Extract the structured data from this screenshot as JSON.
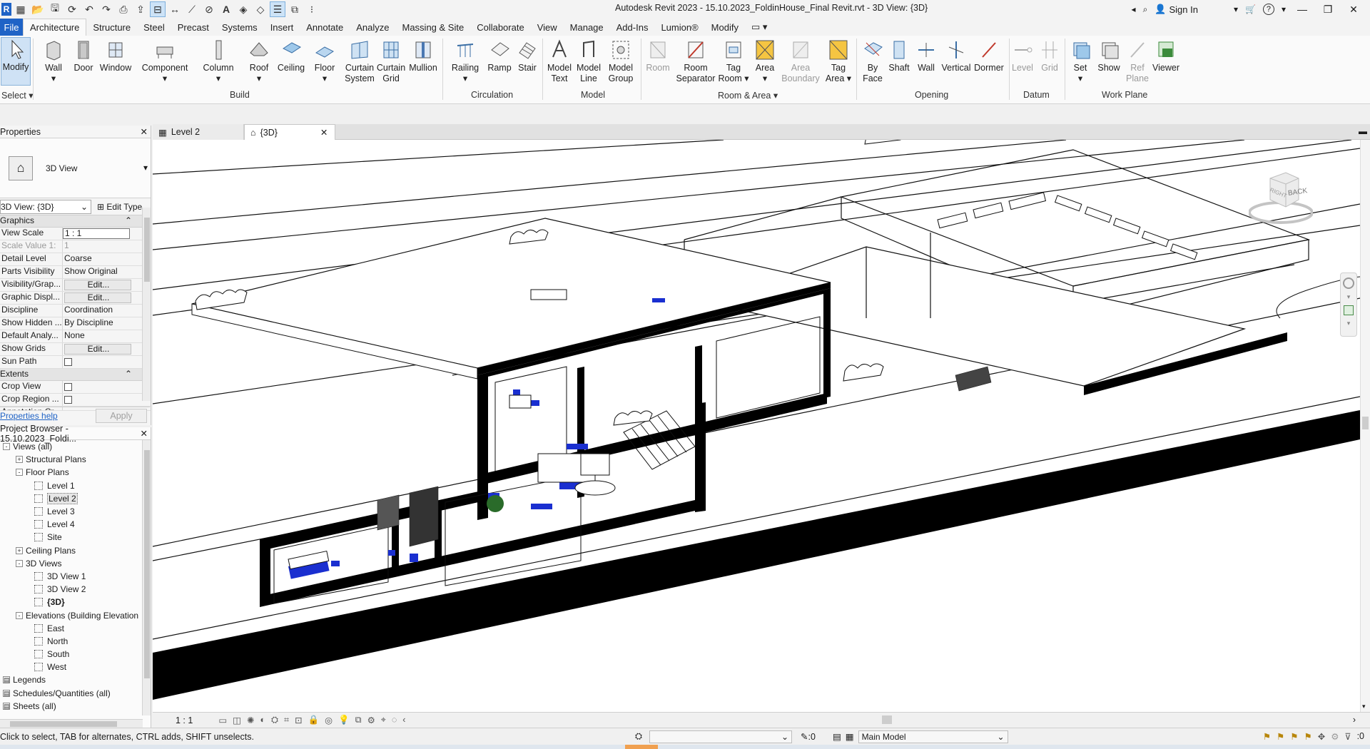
{
  "app": {
    "title": "Autodesk Revit 2023 - 15.10.2023_FoldinHouse_Final Revit.rvt - 3D View: {3D}",
    "logo_letter": "R",
    "sign_in": "Sign In",
    "help": "?",
    "accent_color": "#1f63c6"
  },
  "ribbon_tabs": [
    "File",
    "Architecture",
    "Structure",
    "Steel",
    "Precast",
    "Systems",
    "Insert",
    "Annotate",
    "Analyze",
    "Massing & Site",
    "Collaborate",
    "View",
    "Manage",
    "Add-Ins",
    "Lumion®",
    "Modify"
  ],
  "ribbon": {
    "select": {
      "modify": "Modify",
      "label": "Select"
    },
    "build": {
      "label": "Build",
      "buttons": [
        "Wall",
        "Door",
        "Window",
        "Component",
        "Column",
        "Roof",
        "Ceiling",
        "Floor",
        "Curtain System",
        "Curtain Grid",
        "Mullion"
      ]
    },
    "circulation": {
      "label": "Circulation",
      "buttons": [
        "Railing",
        "Ramp",
        "Stair"
      ]
    },
    "model": {
      "label": "Model",
      "buttons": [
        "Model Text",
        "Model Line",
        "Model Group"
      ]
    },
    "room_area": {
      "label": "Room & Area",
      "buttons": [
        "Room",
        "Room Separator",
        "Tag Room",
        "Area",
        "Area Boundary",
        "Tag Area"
      ]
    },
    "opening": {
      "label": "Opening",
      "buttons": [
        "By Face",
        "Shaft",
        "Wall",
        "Vertical",
        "Dormer"
      ]
    },
    "datum": {
      "label": "Datum",
      "buttons": [
        "Level",
        "Grid"
      ]
    },
    "work_plane": {
      "label": "Work Plane",
      "buttons": [
        "Set",
        "Show",
        "Ref Plane",
        "Viewer"
      ]
    }
  },
  "properties": {
    "header": "Properties",
    "type_name": "3D View",
    "instance_selector": "3D View: {3D}",
    "edit_type": "Edit Type",
    "group_graphics": "Graphics",
    "rows": [
      {
        "k": "View Scale",
        "v": "1 : 1"
      },
      {
        "k": "Scale Value    1:",
        "v": "1"
      },
      {
        "k": "Detail Level",
        "v": "Coarse"
      },
      {
        "k": "Parts Visibility",
        "v": "Show Original"
      },
      {
        "k": "Visibility/Grap...",
        "v": "Edit..."
      },
      {
        "k": "Graphic Displ...",
        "v": "Edit..."
      },
      {
        "k": "Discipline",
        "v": "Coordination"
      },
      {
        "k": "Show Hidden ...",
        "v": "By Discipline"
      },
      {
        "k": "Default Analy...",
        "v": "None"
      },
      {
        "k": "Show Grids",
        "v": "Edit..."
      },
      {
        "k": "Sun Path",
        "v": ""
      }
    ],
    "group_extents": "Extents",
    "extents_rows": [
      {
        "k": "Crop View"
      },
      {
        "k": "Crop Region ..."
      },
      {
        "k": "Annotation Cr..."
      }
    ],
    "help_link": "Properties help",
    "apply": "Apply"
  },
  "browser": {
    "header": "Project Browser - 15.10.2023_Foldi...",
    "nodes": [
      {
        "t": "Views (all)",
        "lvl": 0,
        "exp": "-"
      },
      {
        "t": "Structural Plans",
        "lvl": 1,
        "exp": "+"
      },
      {
        "t": "Floor Plans",
        "lvl": 1,
        "exp": "-"
      },
      {
        "t": "Level 1",
        "lvl": 2
      },
      {
        "t": "Level 2",
        "lvl": 2,
        "sel": true
      },
      {
        "t": "Level 3",
        "lvl": 2
      },
      {
        "t": "Level 4",
        "lvl": 2
      },
      {
        "t": "Site",
        "lvl": 2
      },
      {
        "t": "Ceiling Plans",
        "lvl": 1,
        "exp": "+"
      },
      {
        "t": "3D Views",
        "lvl": 1,
        "exp": "-"
      },
      {
        "t": "3D View 1",
        "lvl": 2
      },
      {
        "t": "3D View 2",
        "lvl": 2
      },
      {
        "t": "{3D}",
        "lvl": 2,
        "bold": true
      },
      {
        "t": "Elevations (Building Elevation",
        "lvl": 1,
        "exp": "-"
      },
      {
        "t": "East",
        "lvl": 2
      },
      {
        "t": "North",
        "lvl": 2
      },
      {
        "t": "South",
        "lvl": 2
      },
      {
        "t": "West",
        "lvl": 2
      },
      {
        "t": "Legends",
        "lvl": 0
      },
      {
        "t": "Schedules/Quantities (all)",
        "lvl": 0
      },
      {
        "t": "Sheets (all)",
        "lvl": 0
      }
    ]
  },
  "doc_tabs": [
    {
      "label": "Level 2",
      "active": false
    },
    {
      "label": "{3D}",
      "active": true
    }
  ],
  "viewcube": {
    "face": "BACK",
    "edge": "RIGHT"
  },
  "view_control": {
    "scale": "1 : 1"
  },
  "status": {
    "message": "Click to select, TAB for alternates, CTRL adds, SHIFT unselects.",
    "count": ":0",
    "model": "Main Model",
    "filter": ":0"
  }
}
